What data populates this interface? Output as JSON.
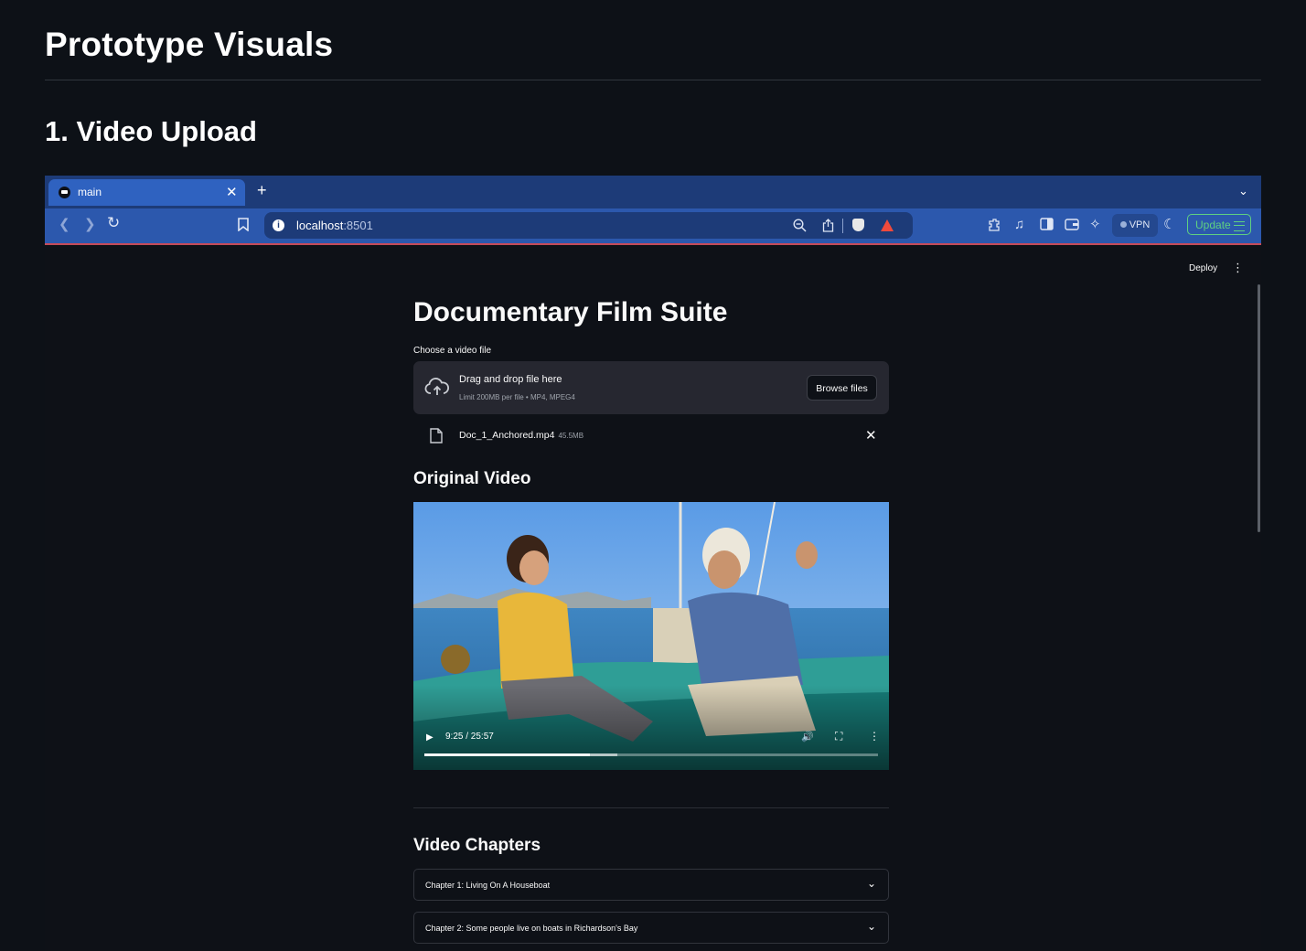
{
  "page": {
    "title": "Prototype Visuals",
    "section_heading": "1. Video Upload"
  },
  "browser": {
    "tab_title": "main",
    "tab_close": "✕",
    "new_tab": "+",
    "url_host": "localhost",
    "url_port": ":8501",
    "vpn_label": "VPN",
    "update_label": "Update"
  },
  "app": {
    "deploy_label": "Deploy",
    "title": "Documentary Film Suite",
    "uploader": {
      "label": "Choose a video file",
      "dropzone_text": "Drag and drop file here",
      "limit_text": "Limit 200MB per file • MP4, MPEG4",
      "browse_label": "Browse files"
    },
    "uploaded_file": {
      "name": "Doc_1_Anchored.mp4",
      "size": "45.5MB"
    },
    "original_video_heading": "Original Video",
    "video": {
      "time": "9:25 / 25:57",
      "played_fraction": 0.365,
      "buffered_fraction": 0.425
    },
    "chapters_heading": "Video Chapters",
    "chapters": [
      {
        "label": "Chapter 1: Living On A Houseboat"
      },
      {
        "label": "Chapter 2: Some people live on boats in Richardson's Bay"
      }
    ]
  },
  "colors": {
    "page_background": "#0d1117",
    "browser_tabstrip": "#1d3b78",
    "browser_toolbar": "#2c58ad",
    "update_accent": "#5fd081",
    "app_background": "#0e1117",
    "dropzone_background": "#262730"
  },
  "icons": [
    "back-icon",
    "forward-icon",
    "reload-icon",
    "bookmark-icon",
    "info-icon",
    "zoom-icon",
    "share-icon",
    "brave-shield-icon",
    "brave-rewards-icon",
    "extensions-icon",
    "music-icon",
    "sidebar-icon",
    "wallet-icon",
    "leo-icon",
    "vpn-icon",
    "theme-icon",
    "cloud-upload-icon",
    "file-icon",
    "close-icon",
    "play-icon",
    "volume-icon",
    "fullscreen-icon",
    "more-icon",
    "chevron-down-icon"
  ]
}
